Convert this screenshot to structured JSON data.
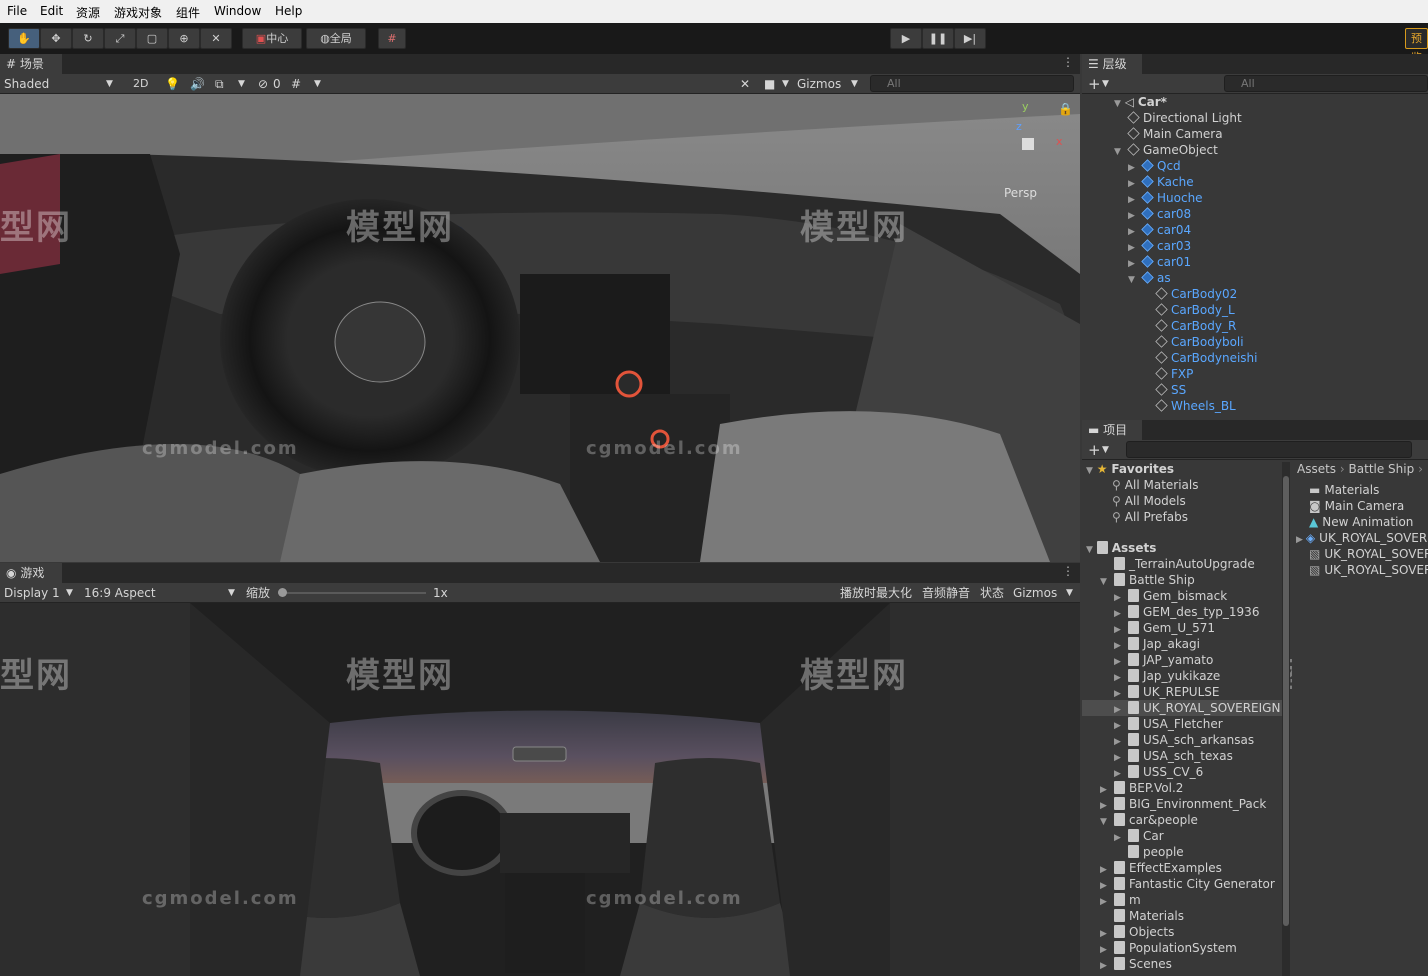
{
  "menu": [
    "File",
    "Edit",
    "资源",
    "游戏对象",
    "组件",
    "Window",
    "Help"
  ],
  "toolbar": {
    "pivot": "中心",
    "global": "全局",
    "preview": "预览"
  },
  "scene": {
    "tab": "场景",
    "shading": "Shaded",
    "mode2d": "2D",
    "gizmos": "Gizmos",
    "search": "All",
    "persp": "Persp",
    "fx_count": "0"
  },
  "game": {
    "tab": "游戏",
    "display": "Display 1",
    "aspect": "16:9 Aspect",
    "scale_label": "缩放",
    "scale_value": "1x",
    "maximize": "播放时最大化",
    "mute": "音频静音",
    "stats": "状态",
    "gizmos": "Gizmos"
  },
  "hierarchy": {
    "tab": "层级",
    "search": "All",
    "root": "Car*",
    "items": [
      {
        "label": "Directional Light",
        "depth": 1,
        "blue": false,
        "prefab": false,
        "arrow": ""
      },
      {
        "label": "Main Camera",
        "depth": 1,
        "blue": false,
        "prefab": false,
        "arrow": ""
      },
      {
        "label": "GameObject",
        "depth": 1,
        "blue": false,
        "prefab": false,
        "arrow": "▼"
      },
      {
        "label": "Qcd",
        "depth": 2,
        "blue": true,
        "prefab": true,
        "arrow": "▶"
      },
      {
        "label": "Kache",
        "depth": 2,
        "blue": true,
        "prefab": true,
        "arrow": "▶"
      },
      {
        "label": "Huoche",
        "depth": 2,
        "blue": true,
        "prefab": true,
        "arrow": "▶"
      },
      {
        "label": "car08",
        "depth": 2,
        "blue": true,
        "prefab": true,
        "arrow": "▶"
      },
      {
        "label": "car04",
        "depth": 2,
        "blue": true,
        "prefab": true,
        "arrow": "▶"
      },
      {
        "label": "car03",
        "depth": 2,
        "blue": true,
        "prefab": true,
        "arrow": "▶"
      },
      {
        "label": "car01",
        "depth": 2,
        "blue": true,
        "prefab": true,
        "arrow": "▶"
      },
      {
        "label": "as",
        "depth": 2,
        "blue": true,
        "prefab": true,
        "arrow": "▼"
      },
      {
        "label": "CarBody02",
        "depth": 3,
        "blue": true,
        "prefab": false,
        "arrow": ""
      },
      {
        "label": "CarBody_L",
        "depth": 3,
        "blue": true,
        "prefab": false,
        "arrow": ""
      },
      {
        "label": "CarBody_R",
        "depth": 3,
        "blue": true,
        "prefab": false,
        "arrow": ""
      },
      {
        "label": "CarBodyboli",
        "depth": 3,
        "blue": true,
        "prefab": false,
        "arrow": ""
      },
      {
        "label": "CarBodyneishi",
        "depth": 3,
        "blue": true,
        "prefab": false,
        "arrow": ""
      },
      {
        "label": "FXP",
        "depth": 3,
        "blue": true,
        "prefab": false,
        "arrow": ""
      },
      {
        "label": "SS",
        "depth": 3,
        "blue": true,
        "prefab": false,
        "arrow": ""
      },
      {
        "label": "Wheels_BL",
        "depth": 3,
        "blue": true,
        "prefab": false,
        "arrow": ""
      }
    ]
  },
  "project": {
    "tab": "项目",
    "breadcrumb": [
      "Assets",
      "Battle Ship"
    ],
    "favorites_label": "Favorites",
    "favorites": [
      "All Materials",
      "All Models",
      "All Prefabs"
    ],
    "assets_label": "Assets",
    "tree": [
      {
        "label": "_TerrainAutoUpgrade",
        "depth": 1,
        "arrow": ""
      },
      {
        "label": "Battle Ship",
        "depth": 1,
        "arrow": "▼"
      },
      {
        "label": "Gem_bismack",
        "depth": 2,
        "arrow": "▶"
      },
      {
        "label": "GEM_des_typ_1936",
        "depth": 2,
        "arrow": "▶"
      },
      {
        "label": "Gem_U_571",
        "depth": 2,
        "arrow": "▶"
      },
      {
        "label": "Jap_akagi",
        "depth": 2,
        "arrow": "▶"
      },
      {
        "label": "JAP_yamato",
        "depth": 2,
        "arrow": "▶"
      },
      {
        "label": "Jap_yukikaze",
        "depth": 2,
        "arrow": "▶"
      },
      {
        "label": "UK_REPULSE",
        "depth": 2,
        "arrow": "▶"
      },
      {
        "label": "UK_ROYAL_SOVEREIGN",
        "depth": 2,
        "arrow": "▶",
        "selected": true
      },
      {
        "label": "USA_Fletcher",
        "depth": 2,
        "arrow": "▶"
      },
      {
        "label": "USA_sch_arkansas",
        "depth": 2,
        "arrow": "▶"
      },
      {
        "label": "USA_sch_texas",
        "depth": 2,
        "arrow": "▶"
      },
      {
        "label": "USS_CV_6",
        "depth": 2,
        "arrow": "▶"
      },
      {
        "label": "BEP.Vol.2",
        "depth": 1,
        "arrow": "▶"
      },
      {
        "label": "BIG_Environment_Pack",
        "depth": 1,
        "arrow": "▶"
      },
      {
        "label": "car&people",
        "depth": 1,
        "arrow": "▼"
      },
      {
        "label": "Car",
        "depth": 2,
        "arrow": "▶"
      },
      {
        "label": "people",
        "depth": 2,
        "arrow": ""
      },
      {
        "label": "EffectExamples",
        "depth": 1,
        "arrow": "▶"
      },
      {
        "label": "Fantastic City Generator",
        "depth": 1,
        "arrow": "▶"
      },
      {
        "label": "m",
        "depth": 1,
        "arrow": "▶"
      },
      {
        "label": "Materials",
        "depth": 1,
        "arrow": ""
      },
      {
        "label": "Objects",
        "depth": 1,
        "arrow": "▶"
      },
      {
        "label": "PopulationSystem",
        "depth": 1,
        "arrow": "▶"
      },
      {
        "label": "Scenes",
        "depth": 1,
        "arrow": "▶"
      }
    ],
    "files": [
      {
        "label": "Materials",
        "icon": "folder"
      },
      {
        "label": "Main Camera",
        "icon": "camera"
      },
      {
        "label": "New Animation",
        "icon": "anim"
      },
      {
        "label": "UK_ROYAL_SOVEREIGN",
        "icon": "prefab"
      },
      {
        "label": "UK_ROYAL_SOVEREIGN",
        "icon": "model"
      },
      {
        "label": "UK_ROYAL_SOVEREIGN",
        "icon": "model"
      }
    ]
  },
  "watermark": {
    "text": "模型网",
    "site": "cgmodel.com"
  }
}
